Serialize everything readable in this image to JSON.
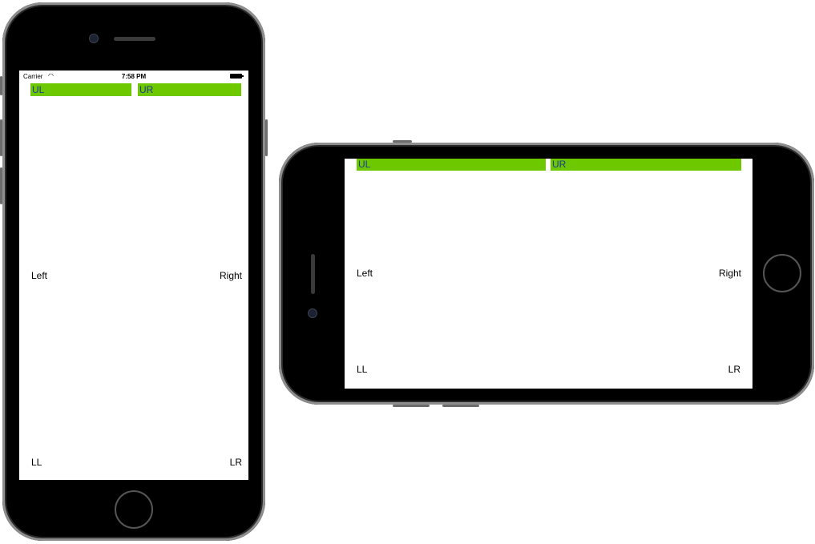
{
  "portrait": {
    "status_bar": {
      "carrier": "Carrier",
      "wifi_icon": "wifi-icon",
      "time": "7:58 PM",
      "battery_icon": "battery-icon"
    },
    "labels": {
      "ul": "UL",
      "ur": "UR",
      "left": "Left",
      "right": "Right",
      "ll": "LL",
      "lr": "LR"
    }
  },
  "landscape": {
    "labels": {
      "ul": "UL",
      "ur": "UR",
      "left": "Left",
      "right": "Right",
      "ll": "LL",
      "lr": "LR"
    }
  },
  "colors": {
    "bar_fill": "#6ec800",
    "bar_text": "#1b3a99",
    "device_body": "#000000"
  }
}
